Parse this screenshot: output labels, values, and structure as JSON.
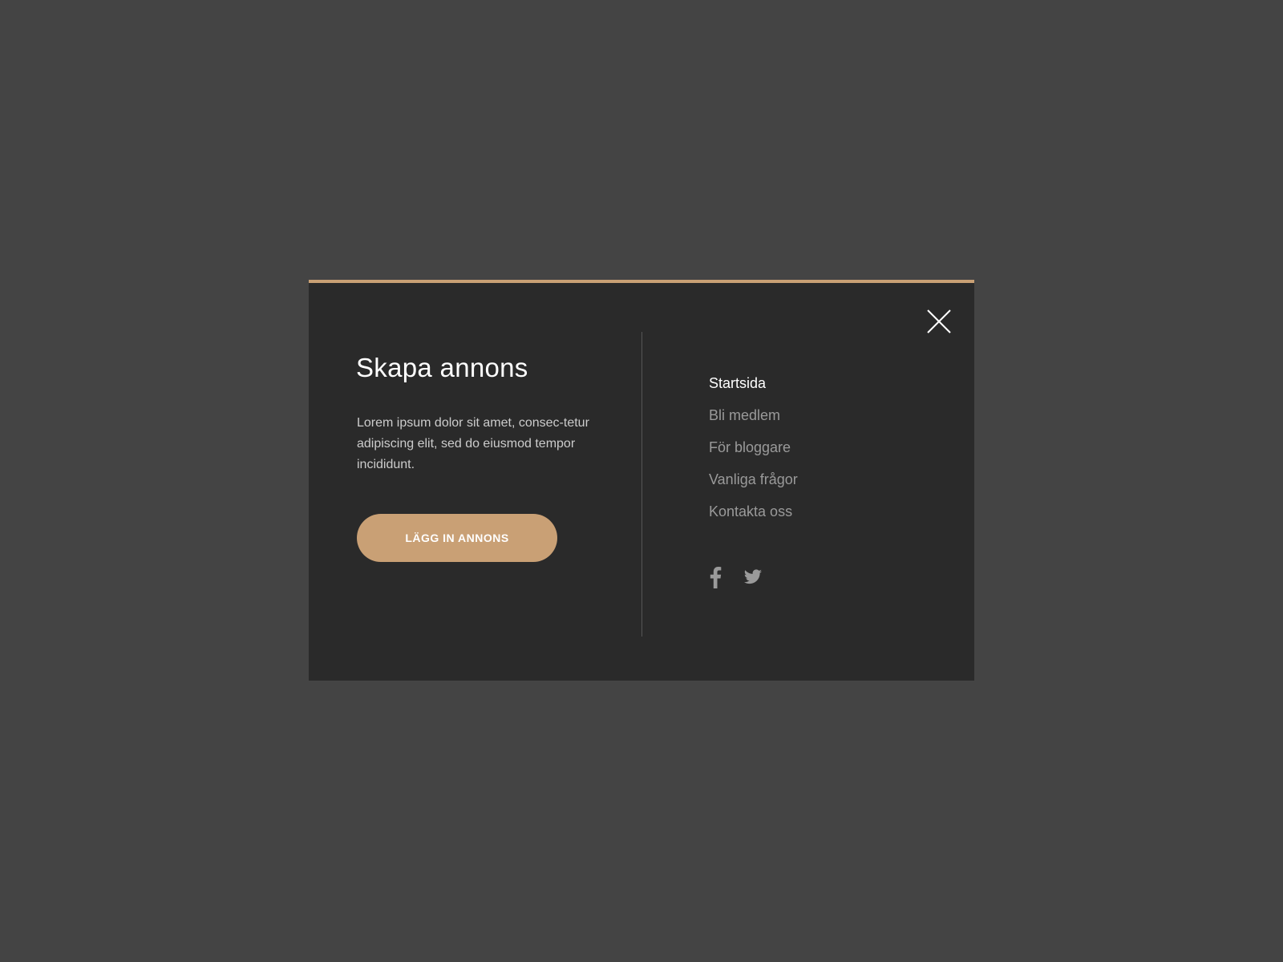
{
  "colors": {
    "backdrop": "#444444",
    "modal_background": "#2a2a2a",
    "accent": "#c9a075",
    "text_primary": "#ffffff",
    "text_muted": "#9a9a9a"
  },
  "modal": {
    "close_icon": "close-icon",
    "left": {
      "title": "Skapa annons",
      "description": "Lorem ipsum dolor sit amet, consec-tetur adipiscing elit, sed do eiusmod tempor incididunt.",
      "cta_label": "LÄGG IN ANNONS"
    },
    "nav": {
      "items": [
        {
          "label": "Startsida",
          "active": true
        },
        {
          "label": "Bli medlem",
          "active": false
        },
        {
          "label": "För bloggare",
          "active": false
        },
        {
          "label": "Vanliga frågor",
          "active": false
        },
        {
          "label": "Kontakta oss",
          "active": false
        }
      ]
    },
    "social": [
      {
        "icon": "facebook-icon"
      },
      {
        "icon": "twitter-icon"
      }
    ]
  }
}
